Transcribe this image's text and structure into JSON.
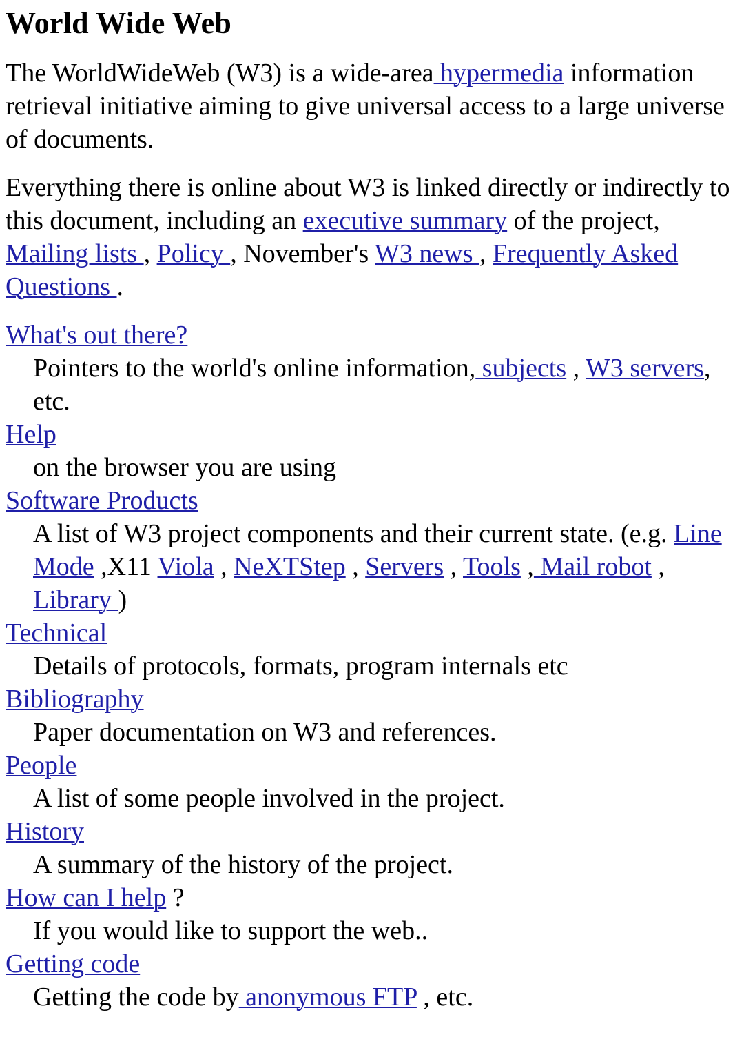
{
  "document": {
    "title": "World Wide Web",
    "link_color": "#1f1fa8",
    "text_color": "#000000",
    "background_color": "#ffffff"
  },
  "intro": {
    "p1": {
      "before": "The WorldWideWeb (W3) is a wide-area",
      "link_hypermedia": " hypermedia",
      "after": " information retrieval initiative aiming to give universal access to a large universe of documents."
    },
    "p2": {
      "before": "Everything there is online about W3 is linked directly or indirectly to this document, including an ",
      "link_executive_summary": "executive summary",
      "mid1": " of the project, ",
      "link_mailing_lists": "Mailing lists ",
      "mid2": ", ",
      "link_policy": "Policy ",
      "mid3": ", November's ",
      "link_w3_news": "W3 news ",
      "mid4": ", ",
      "link_faq": "Frequently Asked Questions ",
      "after": "."
    }
  },
  "definitions": [
    {
      "term_link": "What's out there?",
      "desc_parts": [
        {
          "type": "text",
          "value": "Pointers to the world's online information,"
        },
        {
          "type": "link",
          "value": " subjects"
        },
        {
          "type": "text",
          "value": " , "
        },
        {
          "type": "link",
          "value": "W3 servers"
        },
        {
          "type": "text",
          "value": ", etc."
        }
      ]
    },
    {
      "term_link": "Help",
      "desc_parts": [
        {
          "type": "text",
          "value": "on the browser you are using"
        }
      ]
    },
    {
      "term_link": "Software Products",
      "desc_parts": [
        {
          "type": "text",
          "value": "A list of W3 project components and their current state. (e.g. "
        },
        {
          "type": "link",
          "value": "Line Mode"
        },
        {
          "type": "text",
          "value": " ,X11 "
        },
        {
          "type": "link",
          "value": "Viola"
        },
        {
          "type": "text",
          "value": " , "
        },
        {
          "type": "link",
          "value": "NeXTStep"
        },
        {
          "type": "text",
          "value": " , "
        },
        {
          "type": "link",
          "value": "Servers"
        },
        {
          "type": "text",
          "value": " , "
        },
        {
          "type": "link",
          "value": "Tools"
        },
        {
          "type": "text",
          "value": " ,"
        },
        {
          "type": "link",
          "value": " Mail robot"
        },
        {
          "type": "text",
          "value": " ,"
        },
        {
          "type": "link",
          "value": " Library "
        },
        {
          "type": "text",
          "value": ")"
        }
      ]
    },
    {
      "term_link": "Technical",
      "desc_parts": [
        {
          "type": "text",
          "value": "Details of protocols, formats, program internals etc"
        }
      ]
    },
    {
      "term_link": "Bibliography",
      "desc_parts": [
        {
          "type": "text",
          "value": "Paper documentation on W3 and references."
        }
      ]
    },
    {
      "term_link": "People",
      "desc_parts": [
        {
          "type": "text",
          "value": "A list of some people involved in the project."
        }
      ]
    },
    {
      "term_link": "History",
      "desc_parts": [
        {
          "type": "text",
          "value": "A summary of the history of the project."
        }
      ]
    },
    {
      "term_link": "How can I help",
      "term_suffix": " ?",
      "desc_parts": [
        {
          "type": "text",
          "value": "If you would like to support the web.."
        }
      ]
    },
    {
      "term_link": "Getting code",
      "desc_parts": [
        {
          "type": "text",
          "value": "Getting the code by"
        },
        {
          "type": "link",
          "value": " anonymous FTP"
        },
        {
          "type": "text",
          "value": " , etc."
        }
      ]
    }
  ]
}
